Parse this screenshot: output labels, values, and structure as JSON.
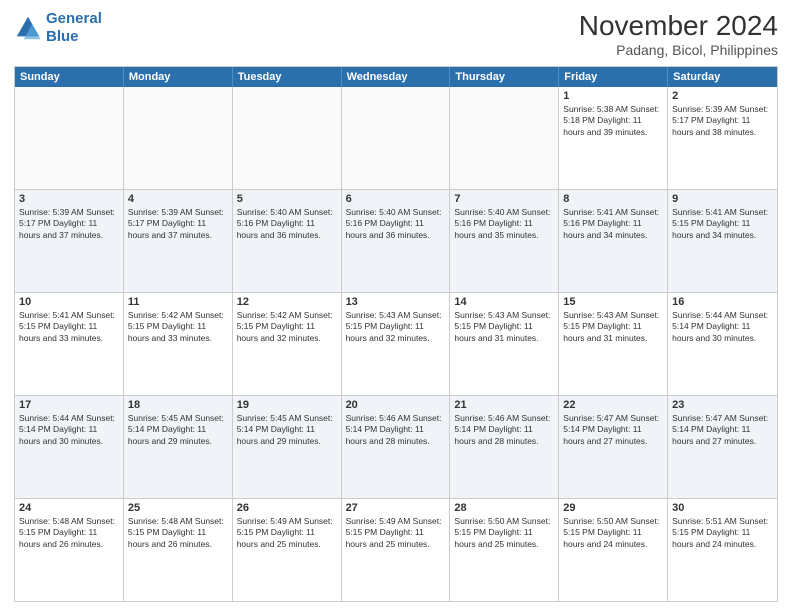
{
  "logo": {
    "line1": "General",
    "line2": "Blue"
  },
  "title": "November 2024",
  "subtitle": "Padang, Bicol, Philippines",
  "days_of_week": [
    "Sunday",
    "Monday",
    "Tuesday",
    "Wednesday",
    "Thursday",
    "Friday",
    "Saturday"
  ],
  "weeks": [
    [
      {
        "day": "",
        "info": "",
        "empty": true
      },
      {
        "day": "",
        "info": "",
        "empty": true
      },
      {
        "day": "",
        "info": "",
        "empty": true
      },
      {
        "day": "",
        "info": "",
        "empty": true
      },
      {
        "day": "",
        "info": "",
        "empty": true
      },
      {
        "day": "1",
        "info": "Sunrise: 5:38 AM\nSunset: 5:18 PM\nDaylight: 11 hours\nand 39 minutes.",
        "empty": false
      },
      {
        "day": "2",
        "info": "Sunrise: 5:39 AM\nSunset: 5:17 PM\nDaylight: 11 hours\nand 38 minutes.",
        "empty": false
      }
    ],
    [
      {
        "day": "3",
        "info": "Sunrise: 5:39 AM\nSunset: 5:17 PM\nDaylight: 11 hours\nand 37 minutes.",
        "empty": false
      },
      {
        "day": "4",
        "info": "Sunrise: 5:39 AM\nSunset: 5:17 PM\nDaylight: 11 hours\nand 37 minutes.",
        "empty": false
      },
      {
        "day": "5",
        "info": "Sunrise: 5:40 AM\nSunset: 5:16 PM\nDaylight: 11 hours\nand 36 minutes.",
        "empty": false
      },
      {
        "day": "6",
        "info": "Sunrise: 5:40 AM\nSunset: 5:16 PM\nDaylight: 11 hours\nand 36 minutes.",
        "empty": false
      },
      {
        "day": "7",
        "info": "Sunrise: 5:40 AM\nSunset: 5:16 PM\nDaylight: 11 hours\nand 35 minutes.",
        "empty": false
      },
      {
        "day": "8",
        "info": "Sunrise: 5:41 AM\nSunset: 5:16 PM\nDaylight: 11 hours\nand 34 minutes.",
        "empty": false
      },
      {
        "day": "9",
        "info": "Sunrise: 5:41 AM\nSunset: 5:15 PM\nDaylight: 11 hours\nand 34 minutes.",
        "empty": false
      }
    ],
    [
      {
        "day": "10",
        "info": "Sunrise: 5:41 AM\nSunset: 5:15 PM\nDaylight: 11 hours\nand 33 minutes.",
        "empty": false
      },
      {
        "day": "11",
        "info": "Sunrise: 5:42 AM\nSunset: 5:15 PM\nDaylight: 11 hours\nand 33 minutes.",
        "empty": false
      },
      {
        "day": "12",
        "info": "Sunrise: 5:42 AM\nSunset: 5:15 PM\nDaylight: 11 hours\nand 32 minutes.",
        "empty": false
      },
      {
        "day": "13",
        "info": "Sunrise: 5:43 AM\nSunset: 5:15 PM\nDaylight: 11 hours\nand 32 minutes.",
        "empty": false
      },
      {
        "day": "14",
        "info": "Sunrise: 5:43 AM\nSunset: 5:15 PM\nDaylight: 11 hours\nand 31 minutes.",
        "empty": false
      },
      {
        "day": "15",
        "info": "Sunrise: 5:43 AM\nSunset: 5:15 PM\nDaylight: 11 hours\nand 31 minutes.",
        "empty": false
      },
      {
        "day": "16",
        "info": "Sunrise: 5:44 AM\nSunset: 5:14 PM\nDaylight: 11 hours\nand 30 minutes.",
        "empty": false
      }
    ],
    [
      {
        "day": "17",
        "info": "Sunrise: 5:44 AM\nSunset: 5:14 PM\nDaylight: 11 hours\nand 30 minutes.",
        "empty": false
      },
      {
        "day": "18",
        "info": "Sunrise: 5:45 AM\nSunset: 5:14 PM\nDaylight: 11 hours\nand 29 minutes.",
        "empty": false
      },
      {
        "day": "19",
        "info": "Sunrise: 5:45 AM\nSunset: 5:14 PM\nDaylight: 11 hours\nand 29 minutes.",
        "empty": false
      },
      {
        "day": "20",
        "info": "Sunrise: 5:46 AM\nSunset: 5:14 PM\nDaylight: 11 hours\nand 28 minutes.",
        "empty": false
      },
      {
        "day": "21",
        "info": "Sunrise: 5:46 AM\nSunset: 5:14 PM\nDaylight: 11 hours\nand 28 minutes.",
        "empty": false
      },
      {
        "day": "22",
        "info": "Sunrise: 5:47 AM\nSunset: 5:14 PM\nDaylight: 11 hours\nand 27 minutes.",
        "empty": false
      },
      {
        "day": "23",
        "info": "Sunrise: 5:47 AM\nSunset: 5:14 PM\nDaylight: 11 hours\nand 27 minutes.",
        "empty": false
      }
    ],
    [
      {
        "day": "24",
        "info": "Sunrise: 5:48 AM\nSunset: 5:15 PM\nDaylight: 11 hours\nand 26 minutes.",
        "empty": false
      },
      {
        "day": "25",
        "info": "Sunrise: 5:48 AM\nSunset: 5:15 PM\nDaylight: 11 hours\nand 26 minutes.",
        "empty": false
      },
      {
        "day": "26",
        "info": "Sunrise: 5:49 AM\nSunset: 5:15 PM\nDaylight: 11 hours\nand 25 minutes.",
        "empty": false
      },
      {
        "day": "27",
        "info": "Sunrise: 5:49 AM\nSunset: 5:15 PM\nDaylight: 11 hours\nand 25 minutes.",
        "empty": false
      },
      {
        "day": "28",
        "info": "Sunrise: 5:50 AM\nSunset: 5:15 PM\nDaylight: 11 hours\nand 25 minutes.",
        "empty": false
      },
      {
        "day": "29",
        "info": "Sunrise: 5:50 AM\nSunset: 5:15 PM\nDaylight: 11 hours\nand 24 minutes.",
        "empty": false
      },
      {
        "day": "30",
        "info": "Sunrise: 5:51 AM\nSunset: 5:15 PM\nDaylight: 11 hours\nand 24 minutes.",
        "empty": false
      }
    ]
  ]
}
